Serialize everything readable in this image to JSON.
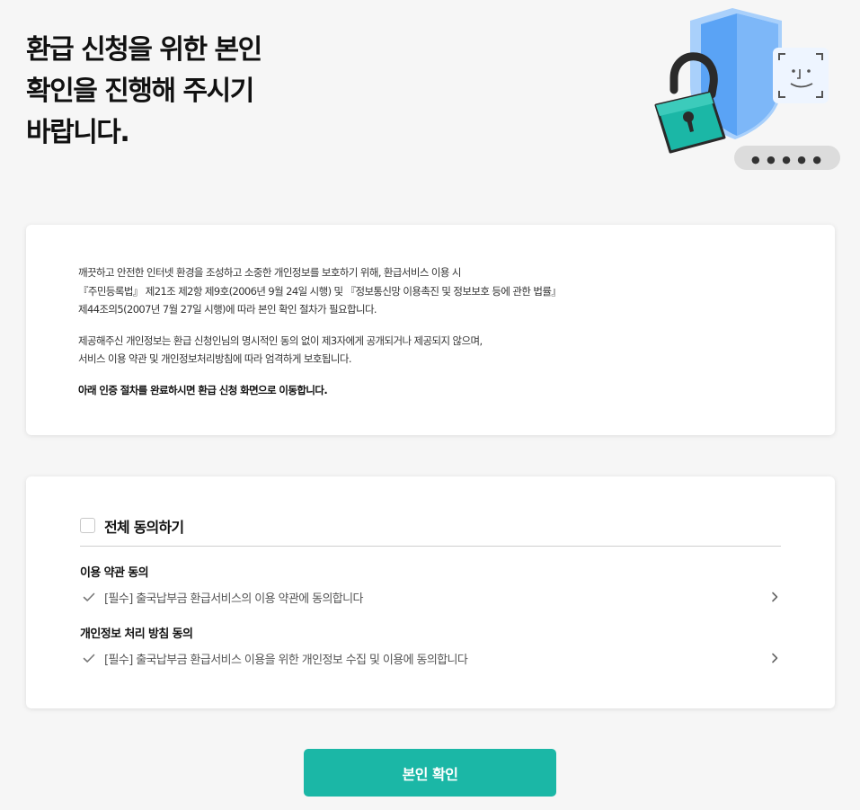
{
  "header": {
    "title_lines": [
      "환급 신청을 위한 본인",
      "확인을 진행해 주시기",
      "바랍니다."
    ]
  },
  "illustration": {
    "password_mask": "● ● ● ● ●",
    "icons": [
      "shield-icon",
      "padlock-icon",
      "face-id-icon"
    ],
    "colors": {
      "shield": "#5aa3f5",
      "lock": "#1bb7a6",
      "lock_dark": "#0e8a7d"
    }
  },
  "notice": {
    "paragraph1": [
      "깨끗하고 안전한 인터넷 환경을 조성하고 소중한 개인정보를 보호하기 위해, 환급서비스 이용 시",
      "『주민등록법』 제21조 제2항 제9호(2006년 9월 24일 시행) 및 『정보통신망 이용촉진 및 정보보호 등에 관한 법률』",
      "제44조의5(2007년 7월 27일 시행)에 따라 본인 확인 절차가 필요합니다."
    ],
    "paragraph2": [
      "제공해주신 개인정보는 환급 신청인님의 명시적인 동의 없이 제3자에게 공개되거나 제공되지 않으며,",
      "서비스 이용 약관 및 개인정보처리방침에 따라 엄격하게 보호됩니다."
    ],
    "paragraph3": "아래 인증 절차를 완료하시면 환급 신청 화면으로 이동합니다."
  },
  "agreement": {
    "all_label": "전체 동의하기",
    "all_checked": false,
    "sections": [
      {
        "title": "이용 약관 동의",
        "item": "[필수] 출국납부금 환급서비스의 이용 약관에 동의합니다"
      },
      {
        "title": "개인정보 처리 방침 동의",
        "item": "[필수] 출국납부금 환급서비스 이용을 위한 개인정보 수집 및 이용에 동의합니다"
      }
    ]
  },
  "confirm_button": {
    "label": "본인 확인",
    "color": "#1bb7a6"
  }
}
